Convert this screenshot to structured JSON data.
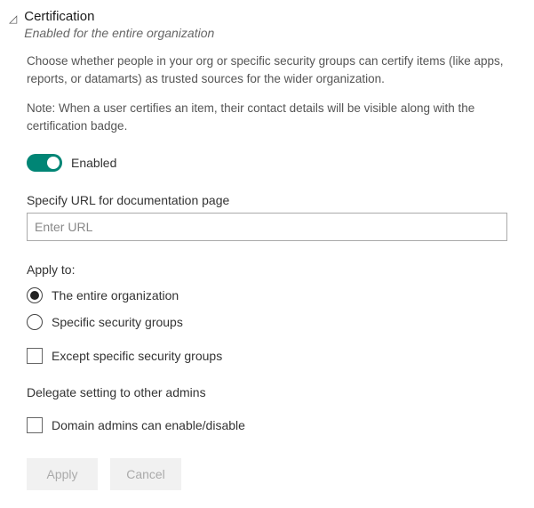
{
  "header": {
    "title": "Certification",
    "subtitle": "Enabled for the entire organization"
  },
  "description": "Choose whether people in your org or specific security groups can certify items (like apps, reports, or datamarts) as trusted sources for the wider organization.",
  "note": "Note: When a user certifies an item, their contact details will be visible along with the certification badge.",
  "toggle": {
    "label": "Enabled"
  },
  "url_field": {
    "label": "Specify URL for documentation page",
    "placeholder": "Enter URL",
    "value": ""
  },
  "apply_to": {
    "label": "Apply to:",
    "options": {
      "entire": "The entire organization",
      "specific": "Specific security groups"
    },
    "except_label": "Except specific security groups"
  },
  "delegate": {
    "label": "Delegate setting to other admins",
    "checkbox_label": "Domain admins can enable/disable"
  },
  "buttons": {
    "apply": "Apply",
    "cancel": "Cancel"
  }
}
